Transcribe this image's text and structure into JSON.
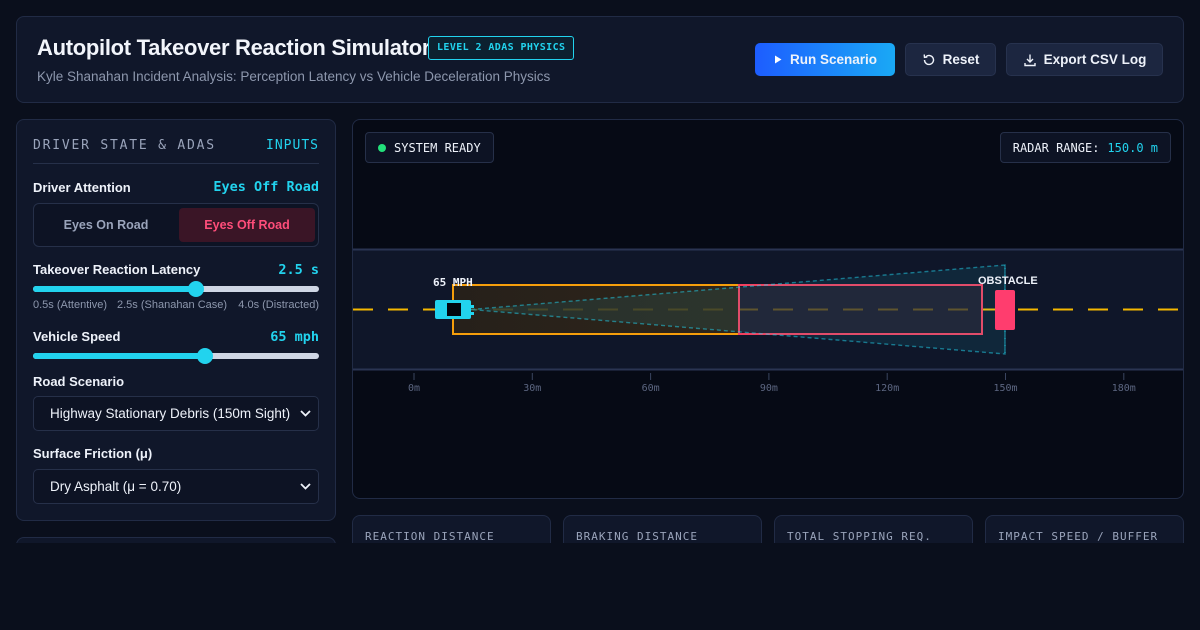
{
  "header": {
    "title": "Autopilot Takeover Reaction Simulator",
    "badge": "LEVEL 2 ADAS PHYSICS",
    "subtitle": "Kyle Shanahan Incident Analysis: Perception Latency vs Vehicle Deceleration Physics",
    "run_label": "Run Scenario",
    "reset_label": "Reset",
    "export_label": "Export CSV Log"
  },
  "panel": {
    "heading_left": "DRIVER STATE & ADAS",
    "heading_right": "INPUTS",
    "attention": {
      "label": "Driver Attention",
      "value": "Eyes Off Road",
      "options": [
        "Eyes On Road",
        "Eyes Off Road"
      ]
    },
    "latency": {
      "label": "Takeover Reaction Latency",
      "value": "2.5 s",
      "fraction": 0.57,
      "ticks": [
        "0.5s (Attentive)",
        "2.5s (Shanahan Case)",
        "4.0s (Distracted)"
      ]
    },
    "speed": {
      "label": "Vehicle Speed",
      "value": "65 mph",
      "fraction": 0.6
    },
    "scenario": {
      "label": "Road Scenario",
      "selected": "Highway Stationary Debris (150m Sight)"
    },
    "friction": {
      "label": "Surface Friction (μ)",
      "selected": "Dry Asphalt (μ = 0.70)"
    }
  },
  "viz": {
    "status": "SYSTEM READY",
    "radar_label": "RADAR RANGE:",
    "radar_value": "150.0 m",
    "speed_label": "65 MPH",
    "obstacle_label": "OBSTACLE",
    "axis_ticks": [
      "0m",
      "30m",
      "60m",
      "90m",
      "120m",
      "150m",
      "180m"
    ],
    "colors": {
      "accent": "#22d3ee",
      "reaction_zone": "#f59e0b",
      "braking_zone": "#f43f5e",
      "obstacle": "#ff3d6e",
      "lane": "#f5b800"
    }
  },
  "cards": [
    "REACTION DISTANCE",
    "BRAKING DISTANCE",
    "TOTAL STOPPING REQ.",
    "IMPACT SPEED / BUFFER"
  ]
}
